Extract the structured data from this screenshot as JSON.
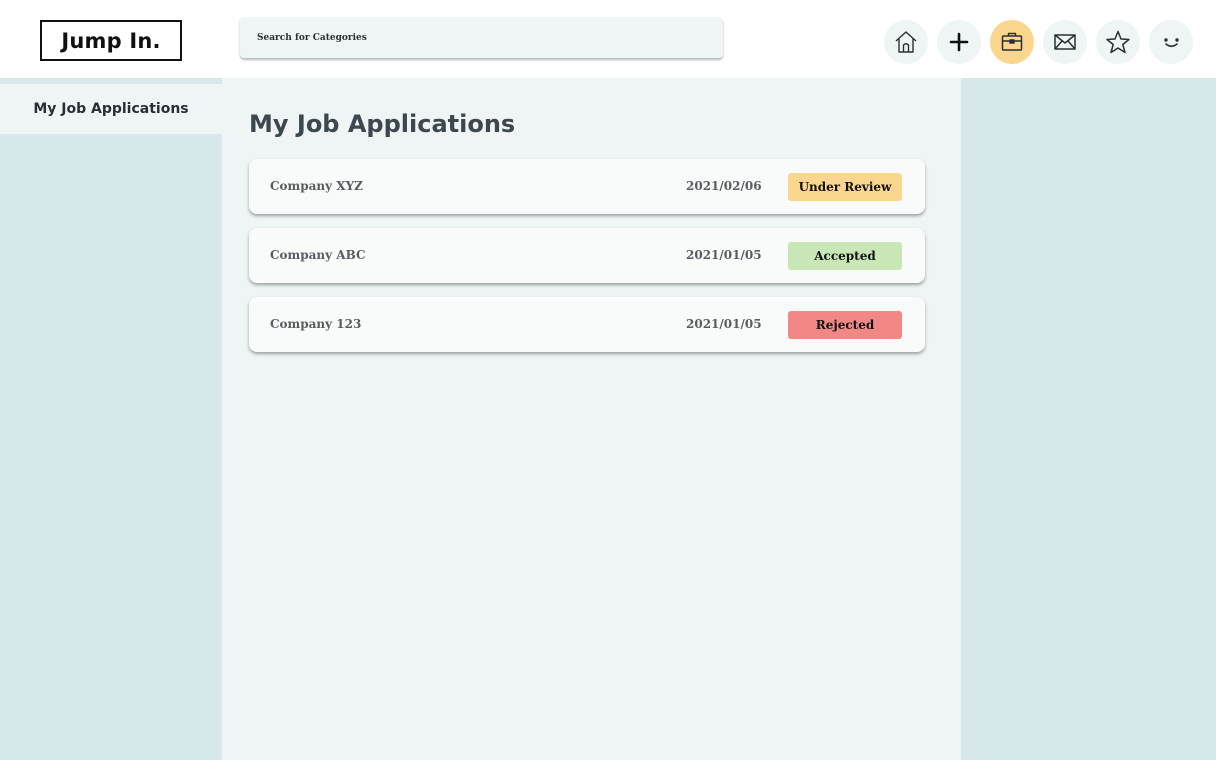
{
  "app": {
    "logo": "Jump In."
  },
  "search": {
    "placeholder": "Search for Categories"
  },
  "nav": {
    "icons": [
      "home-icon",
      "plus-icon",
      "briefcase-icon",
      "mail-icon",
      "star-icon",
      "smiley-icon"
    ],
    "active": "briefcase-icon",
    "active_color": "#fbd68e"
  },
  "sidebar": {
    "items": [
      {
        "label": "My Job Applications"
      }
    ]
  },
  "main": {
    "title": "My Job Applications",
    "applications": [
      {
        "company": "Company XYZ",
        "date": "2021/02/06",
        "status": "Under Review",
        "status_color": "#fbd68e"
      },
      {
        "company": "Company ABC",
        "date": "2021/01/05",
        "status": "Accepted",
        "status_color": "#c9e7b6"
      },
      {
        "company": "Company 123",
        "date": "2021/01/05",
        "status": "Rejected",
        "status_color": "#f28886"
      }
    ]
  },
  "colors": {
    "panel": "#d7e8ea",
    "content": "#eef5f4"
  }
}
